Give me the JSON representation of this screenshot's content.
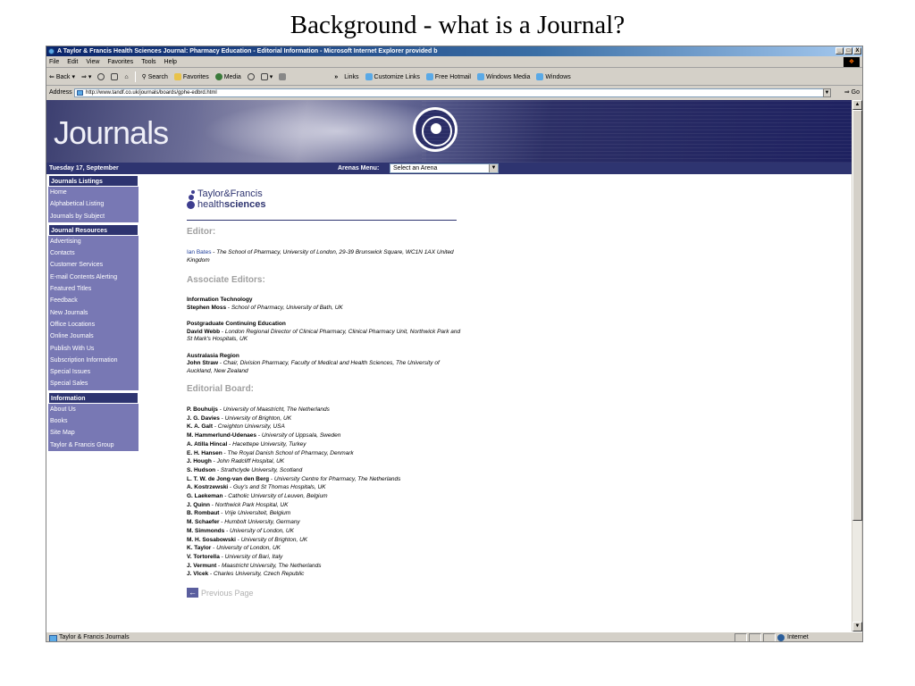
{
  "slide": {
    "title": "Background - what is a Journal?"
  },
  "browser": {
    "window_title": "A Taylor & Francis Health Sciences Journal: Pharmacy Education - Editorial Information - Microsoft Internet Explorer provided b",
    "window_buttons": [
      "_",
      "□",
      "X"
    ],
    "menu": [
      "File",
      "Edit",
      "View",
      "Favorites",
      "Tools",
      "Help"
    ],
    "toolbar": {
      "back": "Back",
      "forward": "⇒",
      "search": "Search",
      "favorites": "Favorites",
      "media": "Media",
      "links_chevron": "»",
      "links_label": "Links",
      "links": [
        "Customize Links",
        "Free Hotmail",
        "Windows Media",
        "Windows"
      ]
    },
    "address": {
      "label": "Address",
      "url": "http://www.tandf.co.uk/journals/boards/gphe-edbrd.html",
      "go": "Go"
    },
    "status": {
      "text": "Taylor & Francis Journals",
      "zone": "Internet"
    }
  },
  "site": {
    "banner_title": "Journals",
    "date": "Tuesday 17, September",
    "arenas_label": "Arenas Menu:",
    "arenas_selected": "Select an Arena",
    "sidebar": {
      "sections": [
        {
          "heading": "Journals Listings",
          "items": [
            "Home",
            "Alphabetical Listing",
            "Journals by Subject"
          ]
        },
        {
          "heading": "Journal Resources",
          "items": [
            "Advertising",
            "Contacts",
            "Customer Services",
            "E-mail Contents Alerting",
            "Featured Titles",
            "Feedback",
            "New Journals",
            "Office Locations",
            "Online Journals",
            "Publish With Us",
            "Subscription Information",
            "Special Issues",
            "Special Sales"
          ]
        },
        {
          "heading": "Information",
          "items": [
            "About Us",
            "Books",
            "Site Map",
            "Taylor & Francis Group"
          ]
        }
      ]
    },
    "logo": {
      "line1": "Taylor&Francis",
      "line2_light": "health",
      "line2_bold": "sciences"
    },
    "editor_heading": "Editor:",
    "editor": {
      "name": "Ian Bates",
      "sep": " - ",
      "affil": "The School of Pharmacy, University of London, 29-39 Brunswick Square, WC1N 1AX United Kingdom"
    },
    "assoc_heading": "Associate Editors:",
    "associates": [
      {
        "area": "Information Technology",
        "name": "Stephen Moss",
        "affil": "School of Pharmacy, University of Bath, UK"
      },
      {
        "area": "Postgraduate Continuing Education",
        "name": "David Webb",
        "affil": "London Regional Director of Clinical Pharmacy, Clinical Pharmacy Unit, Northwick Park and St Mark's Hospitals, UK"
      },
      {
        "area": "Australasia Region",
        "name": "John Straw",
        "affil": "Chair, Division Pharmacy, Faculty of Medical and Health Sciences, The University of Auckland, New Zealand"
      }
    ],
    "board_heading": "Editorial Board:",
    "board": [
      {
        "name": "P. Bouhuijs",
        "affil": "University of Maastricht, The Netherlands"
      },
      {
        "name": "J. G. Davies",
        "affil": "University of Brighton, UK"
      },
      {
        "name": "K. A. Galt",
        "affil": "Creighton University, USA"
      },
      {
        "name": "M. Hammerlund-Udenaes",
        "affil": "University of Uppsala, Sweden"
      },
      {
        "name": "A. Atilla Hincal",
        "affil": "Hacettepe University, Turkey"
      },
      {
        "name": "E. H. Hansen",
        "affil": "The Royal Danish School of Pharmacy, Denmark"
      },
      {
        "name": "J. Hough",
        "affil": "John Radcliff Hospital, UK"
      },
      {
        "name": "S. Hudson",
        "affil": "Strathclyde University, Scotland"
      },
      {
        "name": "L. T. W. de Jong-van den Berg",
        "affil": "University Centre for Pharmacy, The Netherlands"
      },
      {
        "name": "A. Kostrzewski",
        "affil": "Guy's and St Thomas Hospitals, UK"
      },
      {
        "name": "G. Laekeman",
        "affil": "Catholic University of Leuven, Belgium"
      },
      {
        "name": "J. Quinn",
        "affil": "Northwick Park Hospital, UK"
      },
      {
        "name": "B. Rombaut",
        "affil": "Vrije Universiteit, Belgium"
      },
      {
        "name": "M. Schaefer",
        "affil": "Humbolt University, Germany"
      },
      {
        "name": "M. Simmonds",
        "affil": "University of London, UK"
      },
      {
        "name": "M. H. Sosabowski",
        "affil": "University of Brighton, UK"
      },
      {
        "name": "K. Taylor",
        "affil": "University of London, UK"
      },
      {
        "name": "V. Tortorella",
        "affil": "University of Bari, Italy"
      },
      {
        "name": "J. Vermunt",
        "affil": "Maastricht University, The Netherlands"
      },
      {
        "name": "J. Vlcek",
        "affil": "Charles University, Czech Republic"
      }
    ],
    "prev_page": "Previous Page",
    "prev_arrow": "←"
  },
  "colors": {
    "brand_navy": "#2e3470",
    "sidebar_item": "#7878b4",
    "section_heading": "#a0a0a0",
    "link_blue": "#1d3d9a"
  }
}
